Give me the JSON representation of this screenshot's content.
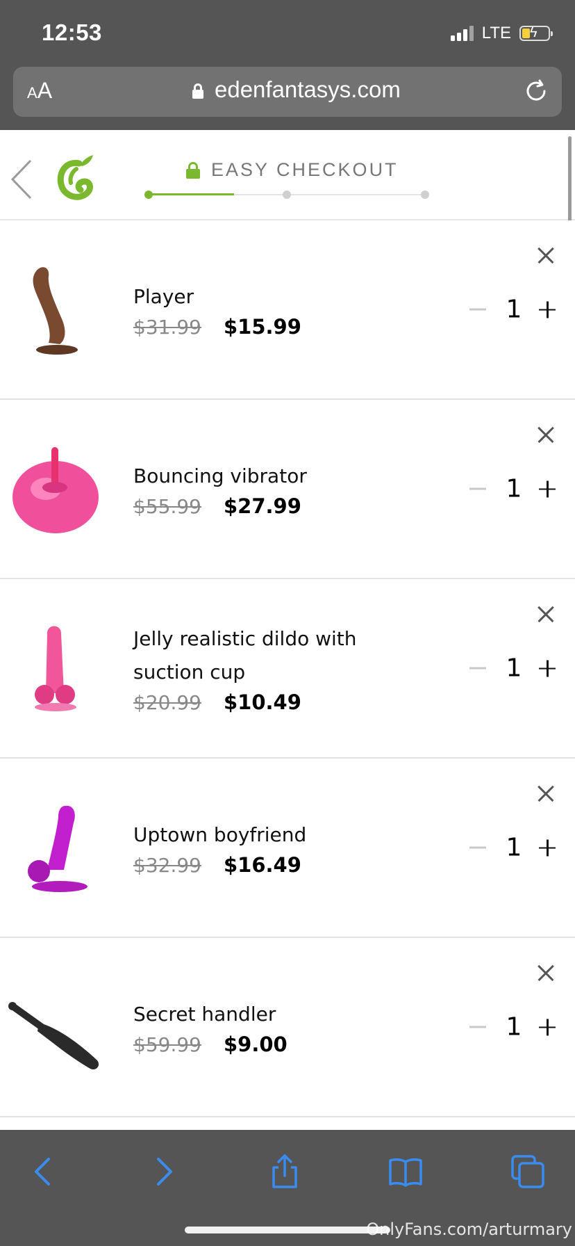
{
  "status_bar": {
    "time": "12:53",
    "network": "LTE",
    "battery_level": 0.3,
    "battery_color": "#f4d13c",
    "charging": true
  },
  "browser": {
    "text_size_button": "AA",
    "url": "edenfantasys.com",
    "lock_icon": "lock-icon",
    "reload_icon": "reload-icon"
  },
  "checkout": {
    "title": "EASY CHECKOUT",
    "accent_color": "#7ab82e",
    "steps_total": 3,
    "current_step": 1
  },
  "cart_items": [
    {
      "name": "Player",
      "old_price": "$31.99",
      "new_price": "$15.99",
      "quantity": "1",
      "thumb_color": "#7a4a30"
    },
    {
      "name": "Bouncing vibrator",
      "old_price": "$55.99",
      "new_price": "$27.99",
      "quantity": "1",
      "thumb_color": "#f04f9b"
    },
    {
      "name": "Jelly realistic dildo with suction cup",
      "old_price": "$20.99",
      "new_price": "$10.49",
      "quantity": "1",
      "thumb_color": "#f2569a"
    },
    {
      "name": "Uptown boyfriend",
      "old_price": "$32.99",
      "new_price": "$16.49",
      "quantity": "1",
      "thumb_color": "#c21fce"
    },
    {
      "name": "Secret handler",
      "old_price": "$59.99",
      "new_price": "$9.00",
      "quantity": "1",
      "thumb_color": "#2a2a2a"
    }
  ],
  "toolbar": {
    "icons": [
      "back-icon",
      "forward-icon",
      "share-icon",
      "bookmarks-icon",
      "tabs-icon"
    ],
    "icon_color": "#3b8cf0"
  },
  "watermark": "OnlyFans.com/arturmary"
}
